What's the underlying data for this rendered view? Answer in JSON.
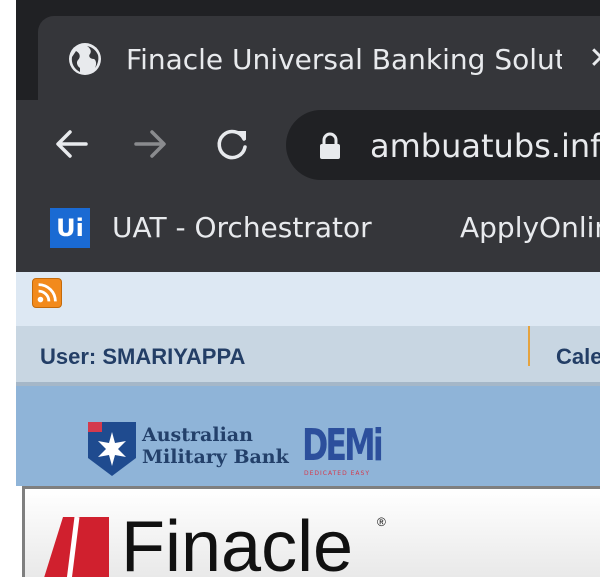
{
  "browser": {
    "tab": {
      "title": "Finacle Universal Banking Solution",
      "icon": "globe-icon",
      "close_glyph": "✕"
    },
    "toolbar": {
      "back_icon": "back-arrow-icon",
      "forward_icon": "forward-arrow-icon",
      "reload_icon": "reload-icon",
      "lock_icon": "lock-icon",
      "url": "ambuatubs.info"
    },
    "bookmarks": [
      {
        "label": "UAT - Orchestrator",
        "icon_text": "Ui"
      },
      {
        "label": "ApplyOnlin"
      }
    ],
    "colors": {
      "chrome_dark": "#202124",
      "chrome_mid": "#35363a",
      "chrome_text": "#e8eaed",
      "uipath_blue": "#1a6ad3"
    }
  },
  "page": {
    "rss_icon": "rss-feed-icon",
    "user_label": "User: SMARIYAPPA",
    "calendar_label": "Cale",
    "brand": {
      "bank_name_line1": "Australian",
      "bank_name_line2": "Military Bank",
      "demi_logo": "DEMi",
      "demi_tagline": "DEDICATED EASY",
      "product": "Finacle",
      "product_tm": "®"
    },
    "colors": {
      "rss_row": "#dde8f3",
      "user_row": "#c8d6e2",
      "user_text": "#233e66",
      "banner": "#8fb4d8",
      "finacle_red": "#d0202e",
      "divider": "#e5a33f"
    }
  }
}
